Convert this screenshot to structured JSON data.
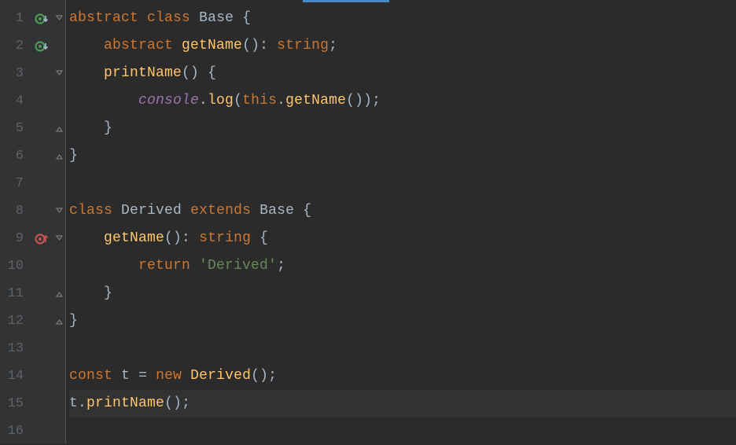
{
  "line_numbers": [
    "1",
    "2",
    "3",
    "4",
    "5",
    "6",
    "7",
    "8",
    "9",
    "10",
    "11",
    "12",
    "13",
    "14",
    "15",
    "16"
  ],
  "gutter_markers": {
    "1": "implemented-down",
    "2": "implemented-down",
    "9": "overrides-up"
  },
  "fold_markers": {
    "1": "open",
    "3": "open",
    "5": "close",
    "6": "close",
    "8": "open",
    "9": "open",
    "11": "close",
    "12": "close"
  },
  "code": {
    "l1": {
      "kw1": "abstract",
      "kw2": "class",
      "name": "Base",
      "b": "{"
    },
    "l2": {
      "indent": "    ",
      "kw": "abstract",
      "fn": "getName",
      "p": "()",
      "c": ":",
      "type": "string",
      "sc": ";"
    },
    "l3": {
      "indent": "    ",
      "fn": "printName",
      "p": "()",
      "b": "{"
    },
    "l4": {
      "indent": "        ",
      "obj": "console",
      "dot": ".",
      "fn": "log",
      "op": "(",
      "this": "this",
      "dot2": ".",
      "m": "getName",
      "cp": "())",
      "sc": ";"
    },
    "l5": {
      "indent": "    ",
      "b": "}"
    },
    "l6": {
      "b": "}"
    },
    "l7": {
      "blank": ""
    },
    "l8": {
      "kw": "class",
      "name": "Derived",
      "ext": "extends",
      "base": "Base",
      "b": "{"
    },
    "l9": {
      "indent": "    ",
      "fn": "getName",
      "p": "()",
      "c": ":",
      "type": "string",
      "b": "{"
    },
    "l10": {
      "indent": "        ",
      "kw": "return",
      "str": "'Derived'",
      "sc": ";"
    },
    "l11": {
      "indent": "    ",
      "b": "}"
    },
    "l12": {
      "b": "}"
    },
    "l13": {
      "blank": ""
    },
    "l14": {
      "kw": "const",
      "v": "t",
      "eq": "=",
      "kw2": "new",
      "cls": "Derived",
      "p": "()",
      "sc": ";"
    },
    "l15": {
      "v": "t",
      "dot": ".",
      "fn": "printName",
      "p": "()",
      "sc": ";"
    },
    "l16": {
      "blank": ""
    }
  }
}
